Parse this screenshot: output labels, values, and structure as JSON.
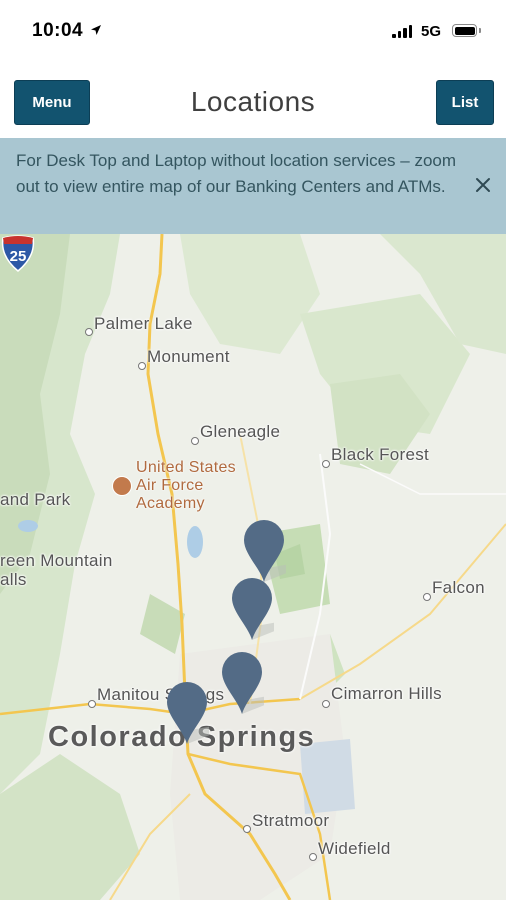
{
  "status_bar": {
    "time": "10:04",
    "network": "5G",
    "icons": [
      "location-arrow-icon",
      "signal-icon",
      "battery-icon"
    ]
  },
  "nav": {
    "menu_label": "Menu",
    "title": "Locations",
    "list_label": "List"
  },
  "banner": {
    "text": "For Desk Top and Laptop without location services – zoom out to view entire map of our Banking Centers and ATMs.",
    "close_icon": "close-icon"
  },
  "map": {
    "places": {
      "palmer_lake": "Palmer Lake",
      "monument": "Monument",
      "gleneagle": "Gleneagle",
      "black_forest": "Black Forest",
      "woodland_park": "and Park",
      "green_mountain": "reen Mountain",
      "falls": "alls",
      "falcon": "Falcon",
      "manitou": "Manitou Springs",
      "cimarron_hills": "Cimarron Hills",
      "stratmoor": "Stratmoor",
      "widefield": "Widefield"
    },
    "city": "Colorado Springs",
    "poi": "United States Air Force Academy",
    "highway_shield": "25",
    "colors": {
      "pin": "#536b86",
      "banner": "#a9c6d1",
      "button": "#12536f",
      "road": "#f5cd5a",
      "park": "#cfe3c1"
    },
    "pins": [
      "location-pin-1",
      "location-pin-2",
      "location-pin-3",
      "location-pin-4"
    ]
  }
}
